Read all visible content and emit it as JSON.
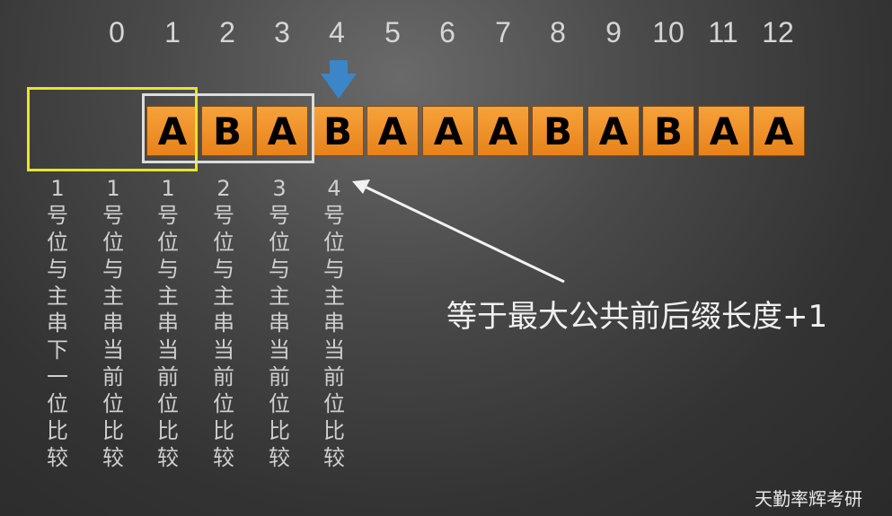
{
  "indices": [
    "0",
    "1",
    "2",
    "3",
    "4",
    "5",
    "6",
    "7",
    "8",
    "9",
    "10",
    "11",
    "12"
  ],
  "pattern_cells": [
    "A",
    "B",
    "A",
    "B",
    "A",
    "A",
    "A",
    "B",
    "A",
    "B",
    "A",
    "A"
  ],
  "columns": [
    [
      "1",
      "号",
      "位",
      "与",
      "主",
      "串",
      "下",
      "一",
      "位",
      "比",
      "较"
    ],
    [
      "1",
      "号",
      "位",
      "与",
      "主",
      "串",
      "当",
      "前",
      "位",
      "比",
      "较"
    ],
    [
      "1",
      "号",
      "位",
      "与",
      "主",
      "串",
      "当",
      "前",
      "位",
      "比",
      "较"
    ],
    [
      "2",
      "号",
      "位",
      "与",
      "主",
      "串",
      "当",
      "前",
      "位",
      "比",
      "较"
    ],
    [
      "3",
      "号",
      "位",
      "与",
      "主",
      "串",
      "当",
      "前",
      "位",
      "比",
      "较"
    ],
    [
      "4",
      "号",
      "位",
      "与",
      "主",
      "串",
      "当",
      "前",
      "位",
      "比",
      "较"
    ]
  ],
  "caption": "等于最大公共前后缀长度+1",
  "watermark": "天勤率辉考研",
  "colors": {
    "cell": "#f09a30",
    "current_arrow": "#3a86c8",
    "highlight_yellow": "#e6e62b",
    "highlight_white": "#dcdcdc"
  }
}
